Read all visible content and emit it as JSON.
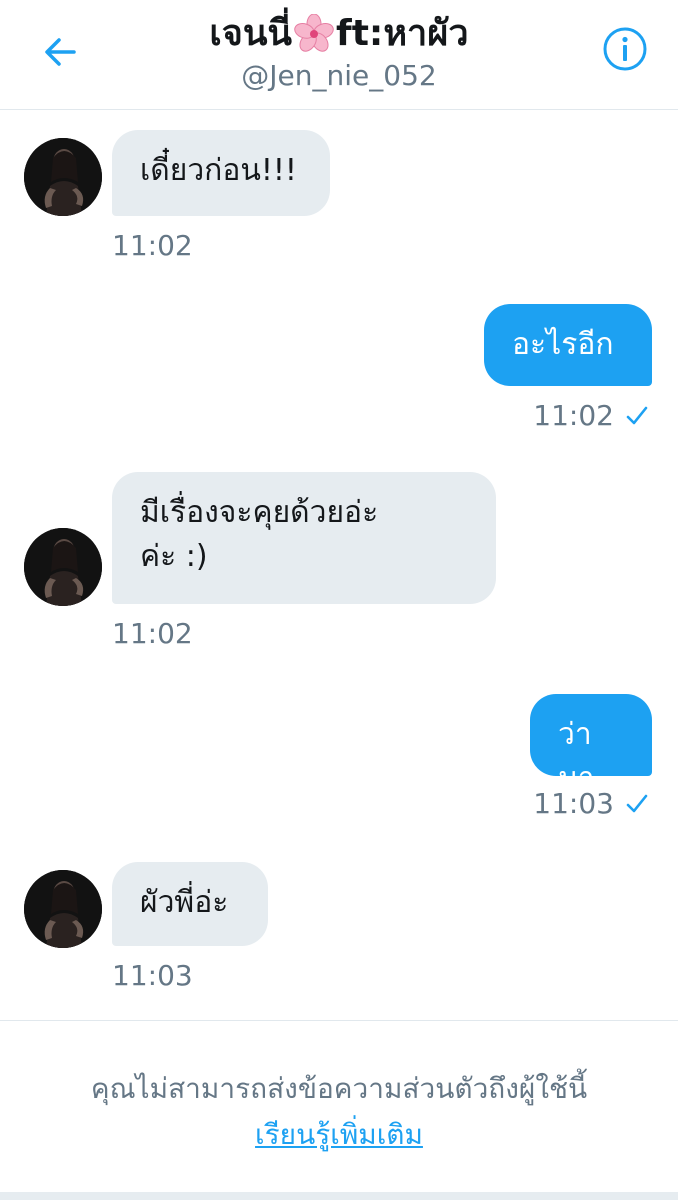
{
  "header": {
    "title_part1": "เจนนี่",
    "title_emoji": "cherry-blossom-icon",
    "title_part2": " ft:หาผัว",
    "handle": "@Jen_nie_052",
    "back_icon": "arrow-left-icon",
    "info_icon": "info-icon"
  },
  "colors": {
    "accent": "#1da1f2",
    "incoming_bubble": "#e6ecf0",
    "muted_text": "#657786"
  },
  "messages": [
    {
      "direction": "in",
      "text": "เดี๋ยวก่อน!!!",
      "time": "11:02"
    },
    {
      "direction": "out",
      "text": "อะไรอีก",
      "time": "11:02",
      "read": true
    },
    {
      "direction": "in",
      "text_line1": "มีเรื่องจะคุยด้วยอ่ะ",
      "text_line2": "ค่ะ :)",
      "time": "11:02"
    },
    {
      "direction": "out",
      "text": "ว่ามา",
      "time": "11:03",
      "read": true
    },
    {
      "direction": "in",
      "text": "ผัวพี่อ่ะ",
      "time": "11:03"
    }
  ],
  "footer": {
    "notice": "คุณไม่สามารถส่งข้อความส่วนตัวถึงผู้ใช้นี้",
    "link": "เรียนรู้เพิ่มเติม"
  }
}
